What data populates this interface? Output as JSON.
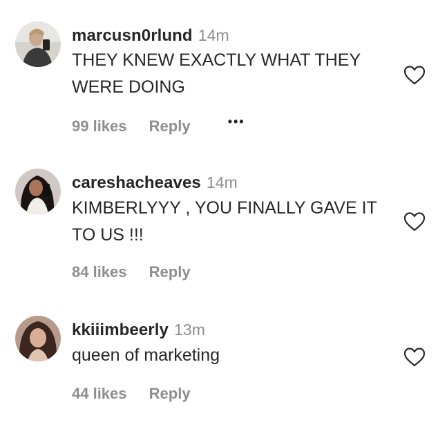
{
  "comments": [
    {
      "username": "marcusn0rlund",
      "time": "14m",
      "text": "THEY KNEW EXACTLY WHAT THEY WERE DOING",
      "likes": "99 likes",
      "reply": "Reply",
      "more": "•••"
    },
    {
      "username": "careshacheaves",
      "time": "14m",
      "text": "KIMBERLYYY , YOU FINALLY GAVE IT TO US !!!",
      "likes": "84 likes",
      "reply": "Reply"
    },
    {
      "username": "kkiiimbeerly",
      "time": "13m",
      "text": "queen of marketing",
      "likes": "44 likes",
      "reply": "Reply"
    }
  ],
  "icons": {
    "like": "heart-outline-icon",
    "more": "more-horizontal-icon"
  },
  "colors": {
    "text": "#262626",
    "muted": "#8e8e8e"
  }
}
